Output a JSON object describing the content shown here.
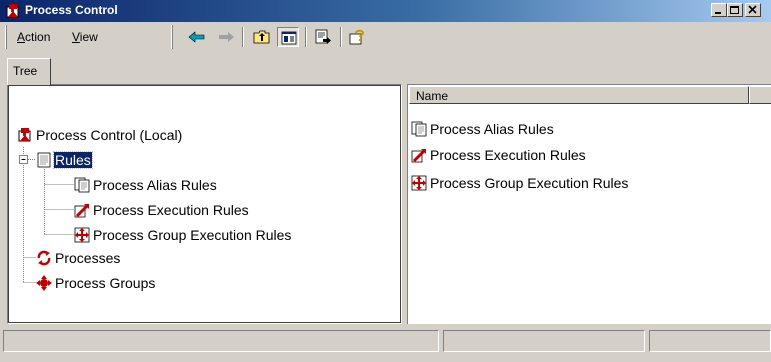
{
  "window": {
    "title": "Process Control",
    "icon": "process-control-icon"
  },
  "menu": {
    "action_label": "Action",
    "action_underline": "A",
    "view_label": "View",
    "view_underline": "V"
  },
  "toolbar": {
    "buttons": [
      "back-icon",
      "forward-icon",
      "up-folder-icon",
      "show-hide-tree-icon",
      "export-list-icon",
      "help-icon"
    ]
  },
  "tree": {
    "tab_label": "Tree",
    "root": {
      "label": "Process Control (Local)",
      "icon": "process-control-icon"
    },
    "rules": {
      "label": "Rules",
      "icon": "rules-document-icon",
      "expanded": true,
      "selected": true
    },
    "rules_children": [
      {
        "label": "Process Alias Rules",
        "icon": "alias-rules-icon"
      },
      {
        "label": "Process Execution Rules",
        "icon": "execution-rules-icon"
      },
      {
        "label": "Process Group Execution Rules",
        "icon": "group-execution-rules-icon"
      }
    ],
    "processes": {
      "label": "Processes",
      "icon": "processes-icon"
    },
    "process_groups": {
      "label": "Process Groups",
      "icon": "process-groups-icon"
    }
  },
  "list": {
    "column_name": "Name",
    "items": [
      {
        "label": "Process Alias Rules",
        "icon": "alias-rules-icon"
      },
      {
        "label": "Process Execution Rules",
        "icon": "execution-rules-icon"
      },
      {
        "label": "Process Group Execution Rules",
        "icon": "group-execution-rules-icon"
      }
    ]
  },
  "colors": {
    "title_gradient_start": "#0a246a",
    "title_gradient_end": "#a6caf0",
    "selection": "#0a246a",
    "face": "#d4d0c8"
  }
}
